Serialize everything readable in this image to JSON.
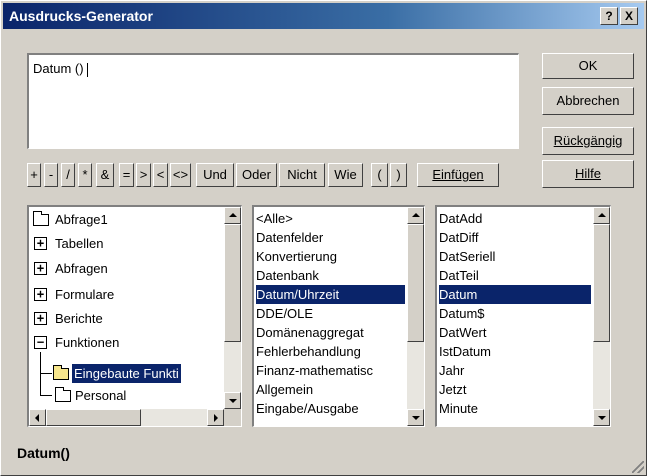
{
  "window": {
    "title": "Ausdrucks-Generator",
    "help_button": "?",
    "close_button": "X"
  },
  "expression": {
    "value": "Datum ()"
  },
  "buttons": {
    "ok": "OK",
    "cancel": "Abbrechen",
    "undo": "Rückgängig",
    "help": "Hilfe",
    "paste": "Einfügen"
  },
  "operators": [
    "+",
    "-",
    "/",
    "*",
    "&",
    "=",
    ">",
    "<",
    "<>",
    "Und",
    "Oder",
    "Nicht",
    "Wie",
    "(",
    ")"
  ],
  "tree": {
    "items": [
      {
        "label": "Abfrage1",
        "icon": "folder-icon"
      },
      {
        "label": "Tabellen",
        "icon": "expand-plus-icon"
      },
      {
        "label": "Abfragen",
        "icon": "expand-plus-icon"
      },
      {
        "label": "Formulare",
        "icon": "expand-plus-icon"
      },
      {
        "label": "Berichte",
        "icon": "expand-plus-icon"
      },
      {
        "label": "Funktionen",
        "icon": "collapse-minus-icon"
      },
      {
        "label": "Eingebaute Funkti",
        "icon": "open-folder-icon",
        "selected": true
      },
      {
        "label": "Personal",
        "icon": "folder-icon"
      }
    ]
  },
  "categories": {
    "items": [
      "<Alle>",
      "Datenfelder",
      "Konvertierung",
      "Datenbank",
      "Datum/Uhrzeit",
      "DDE/OLE",
      "Domänenaggregat",
      "Fehlerbehandlung",
      "Finanz-mathematisc",
      "Allgemein",
      "Eingabe/Ausgabe"
    ],
    "selected_index": 4
  },
  "functions": {
    "items": [
      "DatAdd",
      "DatDiff",
      "DatSeriell",
      "DatTeil",
      "Datum",
      "Datum$",
      "DatWert",
      "IstDatum",
      "Jahr",
      "Jetzt",
      "Minute"
    ],
    "selected_index": 4
  },
  "status": {
    "text": "Datum()"
  },
  "colors": {
    "selection": "#0a246a",
    "face": "#d4d0c8"
  }
}
